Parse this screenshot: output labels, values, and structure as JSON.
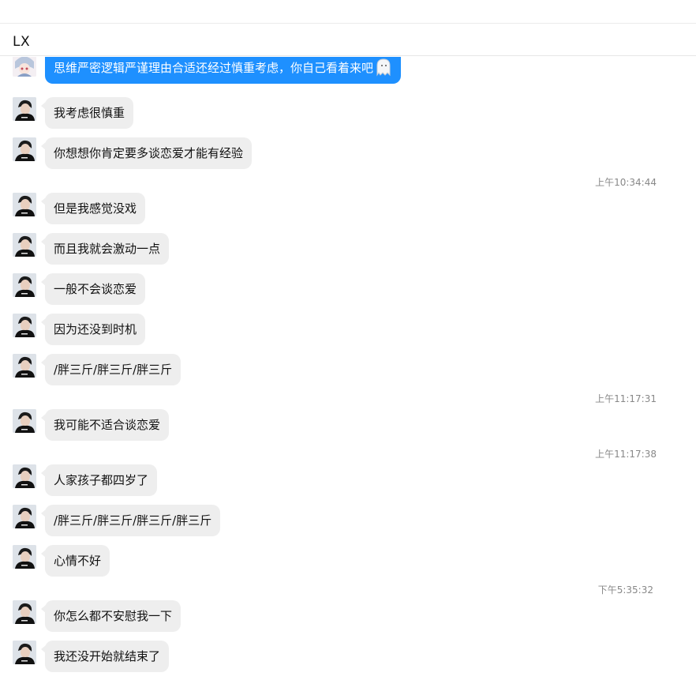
{
  "header": {
    "title": "LX"
  },
  "colors": {
    "bubble_blue": "#1e90ff",
    "bubble_gray": "#eeeeee",
    "timestamp": "#888888"
  },
  "messages": [
    {
      "text": "思维严密逻辑严谨理由合适还经过慎重考虑，你自己看着来吧",
      "style": "blue",
      "avatar": "anime-avatar",
      "emoji": "ghost-icon"
    },
    {
      "text": "我考虑很慎重"
    },
    {
      "text": "你想想你肯定要多谈恋爱才能有经验"
    },
    {
      "text": "但是我感觉没戏"
    },
    {
      "text": "而且我就会激动一点"
    },
    {
      "text": "一般不会谈恋爱"
    },
    {
      "text": "因为还没到时机"
    },
    {
      "text": "/胖三斤/胖三斤/胖三斤"
    },
    {
      "text": "我可能不适合谈恋爱"
    },
    {
      "text": "人家孩子都四岁了"
    },
    {
      "text": "/胖三斤/胖三斤/胖三斤/胖三斤"
    },
    {
      "text": "心情不好"
    },
    {
      "text": "你怎么都不安慰我一下"
    },
    {
      "text": "我还没开始就结束了"
    }
  ],
  "timestamps": [
    "上午10:34:44",
    "上午11:17:31",
    "上午11:17:38",
    "下午5:35:32"
  ]
}
